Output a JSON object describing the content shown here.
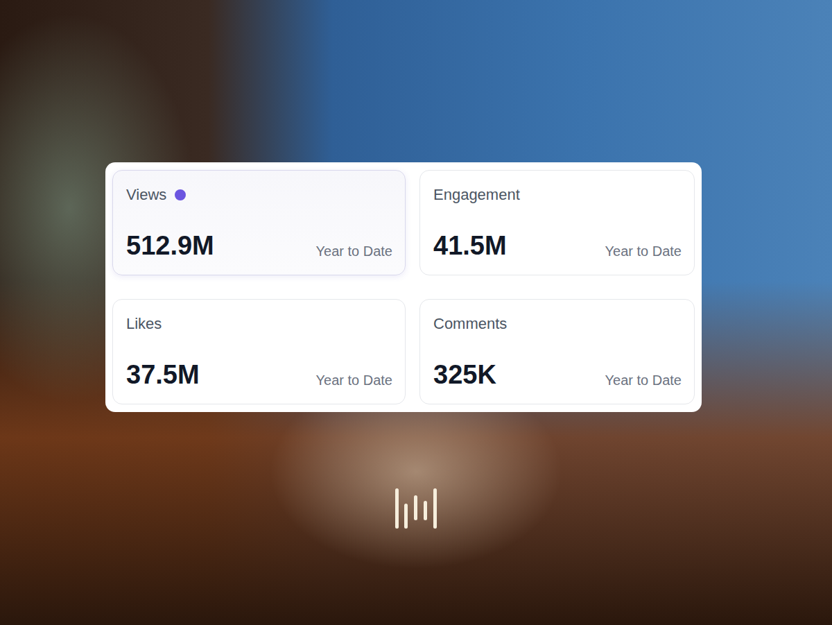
{
  "stats": [
    {
      "label": "Views",
      "value": "512.9M",
      "period": "Year to Date",
      "selected": true
    },
    {
      "label": "Engagement",
      "value": "41.5M",
      "period": "Year to Date",
      "selected": false
    },
    {
      "label": "Likes",
      "value": "37.5M",
      "period": "Year to Date",
      "selected": false
    },
    {
      "label": "Comments",
      "value": "325K",
      "period": "Year to Date",
      "selected": false
    }
  ]
}
